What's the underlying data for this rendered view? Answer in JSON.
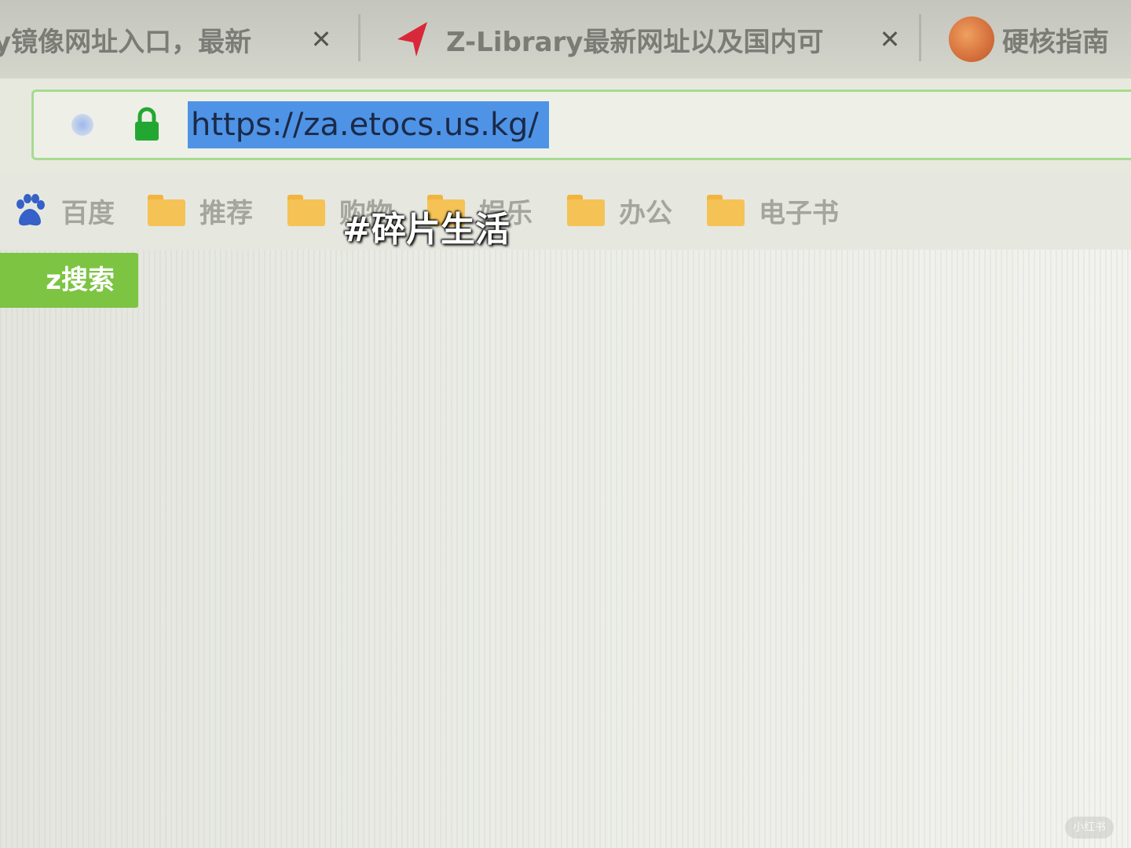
{
  "browser": {
    "tabs": [
      {
        "title": "y镜像网址入口，最新",
        "close_label": "✕"
      },
      {
        "title": "Z-Library最新网址以及国内可",
        "close_label": "✕"
      },
      {
        "title": "硬核指南"
      }
    ],
    "address_bar": {
      "url": "https://za.etocs.us.kg/",
      "selected": true
    },
    "bookmarks": [
      {
        "label": "百度",
        "icon": "baidu-paw-icon"
      },
      {
        "label": "推荐",
        "icon": "folder-icon"
      },
      {
        "label": "购物",
        "icon": "folder-icon"
      },
      {
        "label": "娱乐",
        "icon": "folder-icon"
      },
      {
        "label": "办公",
        "icon": "folder-icon"
      },
      {
        "label": "电子书",
        "icon": "folder-icon"
      }
    ]
  },
  "page": {
    "green_button_label": "z搜索",
    "watermark": "小红书"
  },
  "overlay": {
    "hashtag": "#碎片生活"
  },
  "colors": {
    "selection": "#4f93e6",
    "address_border": "#a6db8e",
    "lock": "#23a733",
    "folder": "#f5c256",
    "green_button": "#7cc442",
    "zlib_icon": "#d8283a"
  }
}
